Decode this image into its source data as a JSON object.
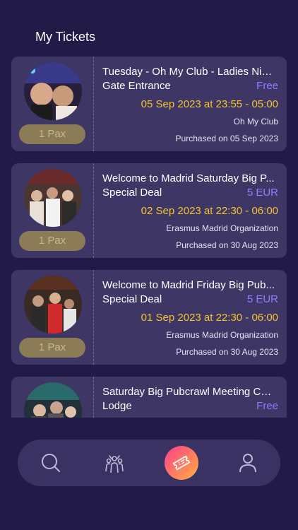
{
  "page": {
    "title": "My Tickets"
  },
  "tickets": [
    {
      "title": "Tuesday - Oh My Club - Ladies Night",
      "type": "Gate Entrance",
      "price": "Free",
      "date": "05 Sep 2023 at 23:55 - 05:00",
      "organizer": "Oh My Club",
      "purchased": "Purchased on 05 Sep 2023",
      "pax": "1 Pax"
    },
    {
      "title": "Welcome to Madrid Saturday Big P...",
      "type": "Special Deal",
      "price": "5 EUR",
      "date": "02 Sep 2023 at 22:30 - 06:00",
      "organizer": "Erasmus Madrid Organization",
      "purchased": "Purchased on 30 Aug 2023",
      "pax": "1 Pax"
    },
    {
      "title": "Welcome to Madrid Friday Big Pub...",
      "type": "Special Deal",
      "price": "5 EUR",
      "date": "01 Sep 2023 at 22:30 - 06:00",
      "organizer": "Erasmus Madrid Organization",
      "purchased": "Purchased on 30 Aug 2023",
      "pax": "1 Pax"
    },
    {
      "title": "Saturday Big Pubcrawl Meeting Car...",
      "type": "Lodge",
      "price": "Free",
      "date": "",
      "organizer": "",
      "purchased": "",
      "pax": ""
    }
  ],
  "nav": {
    "items": [
      {
        "icon": "search-icon"
      },
      {
        "icon": "crowd-icon"
      },
      {
        "icon": "ticket-icon"
      },
      {
        "icon": "profile-icon"
      }
    ],
    "active": "ticket-icon"
  }
}
